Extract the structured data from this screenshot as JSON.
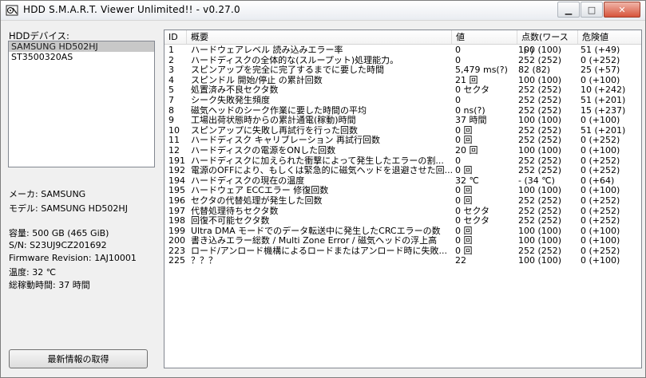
{
  "window": {
    "title": "HDD S.M.A.R.T. Viewer Unlimited!! - v0.27.0"
  },
  "left": {
    "devices_label": "HDDデバイス:",
    "devices": [
      "SAMSUNG HD502HJ",
      "ST3500320AS"
    ],
    "info": {
      "maker": "メーカ: SAMSUNG",
      "model": "モデル: SAMSUNG HD502HJ",
      "capacity": "容量: 500 GB (465 GiB)",
      "serial": "S/N: S23UJ9CZ201692",
      "firmware": "Firmware Revision: 1AJ10001",
      "temperature": "温度: 32 ℃",
      "uptime": "総稼動時間: 37 時間"
    },
    "refresh_label": "最新情報の取得"
  },
  "table": {
    "headers": {
      "id": "ID",
      "name": "概要",
      "value": "値",
      "points": "点数(ワースト)",
      "threshold": "危険値"
    },
    "rows": [
      {
        "id": "1",
        "name": "ハードウェアレベル 読み込みエラー率",
        "value": "0",
        "points": "100 (100)",
        "threshold": "51 (+49)"
      },
      {
        "id": "2",
        "name": "ハードディスクの全体的な(スループット)処理能力。",
        "value": "0",
        "points": "252 (252)",
        "threshold": "0 (+252)"
      },
      {
        "id": "3",
        "name": "スピンアップを完全に完了するまでに要した時間",
        "value": "5,479 ms(?)",
        "points": "82 (82)",
        "threshold": "25 (+57)"
      },
      {
        "id": "4",
        "name": "スピンドル 開始/停止 の累計回数",
        "value": "21 回",
        "points": "100 (100)",
        "threshold": "0 (+100)"
      },
      {
        "id": "5",
        "name": "処置済み不良セクタ数",
        "value": "0 セクタ",
        "points": "252 (252)",
        "threshold": "10 (+242)"
      },
      {
        "id": "7",
        "name": "シーク失敗発生頻度",
        "value": "0",
        "points": "252 (252)",
        "threshold": "51 (+201)"
      },
      {
        "id": "8",
        "name": "磁気ヘッドのシーク作業に要した時間の平均",
        "value": "0 ns(?)",
        "points": "252 (252)",
        "threshold": "15 (+237)"
      },
      {
        "id": "9",
        "name": "工場出荷状態時からの累計通電(稼動)時間",
        "value": "37 時間",
        "points": "100 (100)",
        "threshold": "0 (+100)"
      },
      {
        "id": "10",
        "name": "スピンアップに失敗し再試行を行った回数",
        "value": "0 回",
        "points": "252 (252)",
        "threshold": "51 (+201)"
      },
      {
        "id": "11",
        "name": "ハードディスク キャリブレーション 再試行回数",
        "value": "0 回",
        "points": "252 (252)",
        "threshold": "0 (+252)"
      },
      {
        "id": "12",
        "name": "ハードディスクの電源をONした回数",
        "value": "20 回",
        "points": "100 (100)",
        "threshold": "0 (+100)"
      },
      {
        "id": "191",
        "name": "ハードディスクに加えられた衝撃によって発生したエラーの割...",
        "value": "0",
        "points": "252 (252)",
        "threshold": "0 (+252)"
      },
      {
        "id": "192",
        "name": "電源のOFFにより、もしくは緊急的に磁気ヘッドを退避させた回...",
        "value": "0 回",
        "points": "252 (252)",
        "threshold": "0 (+252)"
      },
      {
        "id": "194",
        "name": "ハードディスクの現在の温度",
        "value": "32 ℃",
        "points": "- (34 ℃)",
        "threshold": "0 (+64)"
      },
      {
        "id": "195",
        "name": "ハードウェア ECCエラー 修復回数",
        "value": "0 回",
        "points": "100 (100)",
        "threshold": "0 (+100)"
      },
      {
        "id": "196",
        "name": "セクタの代替処理が発生した回数",
        "value": "0 回",
        "points": "252 (252)",
        "threshold": "0 (+252)"
      },
      {
        "id": "197",
        "name": "代替処理待ちセクタ数",
        "value": "0 セクタ",
        "points": "252 (252)",
        "threshold": "0 (+252)"
      },
      {
        "id": "198",
        "name": "回復不可能セクタ数",
        "value": "0 セクタ",
        "points": "252 (252)",
        "threshold": "0 (+252)"
      },
      {
        "id": "199",
        "name": "Ultra DMA モードでのデータ転送中に発生したCRCエラーの数",
        "value": "0 回",
        "points": "100 (100)",
        "threshold": "0 (+100)"
      },
      {
        "id": "200",
        "name": "書き込みエラー総数 / Multi Zone Error / 磁気ヘッドの浮上高",
        "value": "0 回",
        "points": "100 (100)",
        "threshold": "0 (+100)"
      },
      {
        "id": "223",
        "name": "ロード/アンロード機構によるロードまたはアンロード時に失敗...",
        "value": "0 回",
        "points": "252 (252)",
        "threshold": "0 (+252)"
      },
      {
        "id": "225",
        "name": "？？？",
        "value": "22",
        "points": "100 (100)",
        "threshold": "0 (+100)"
      }
    ]
  }
}
